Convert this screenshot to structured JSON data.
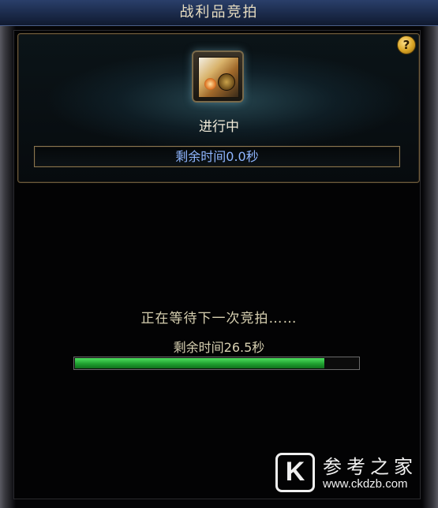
{
  "window": {
    "title": "战利品竞拍"
  },
  "auction": {
    "status": "进行中",
    "remaining_label": "剩余时间0.0秒"
  },
  "help": {
    "label": "?"
  },
  "next_auction": {
    "waiting_text": "正在等待下一次竞拍……",
    "remaining_label": "剩余时间26.5秒",
    "progress_fraction": 0.88
  },
  "watermark": {
    "logo_letter": "K",
    "name": "参考之家",
    "url": "www.ckdzb.com"
  },
  "colors": {
    "progress_green": "#1fa030",
    "timer_text": "#8fb6ff",
    "help_gold": "#d9a424"
  }
}
